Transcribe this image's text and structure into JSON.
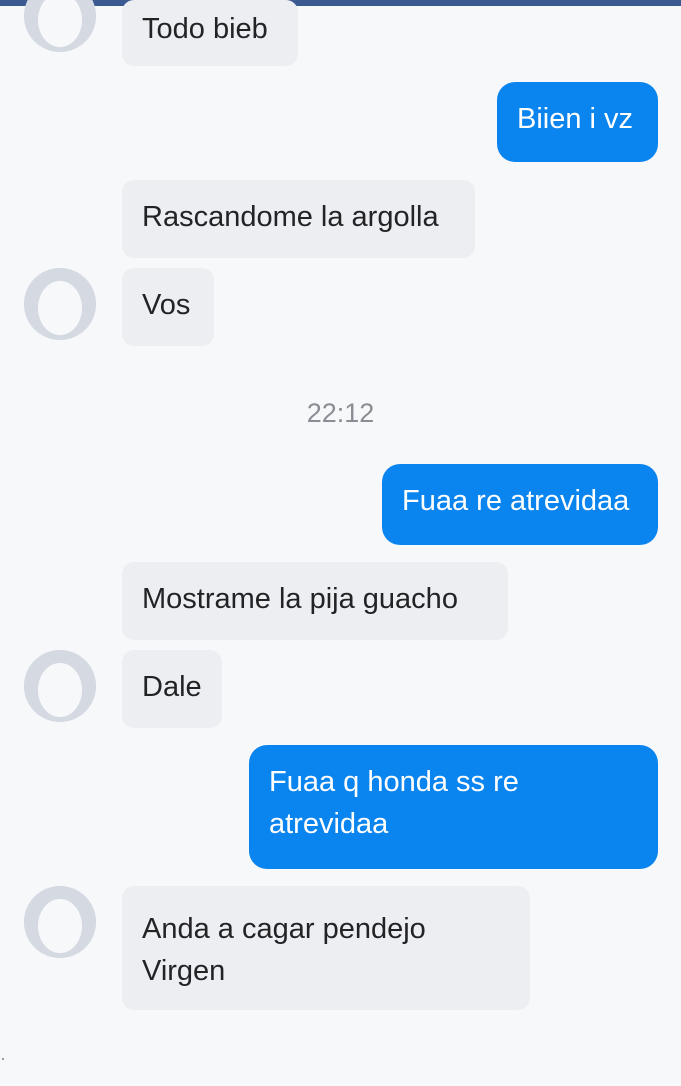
{
  "conversation": {
    "messages": [
      {
        "direction": "incoming",
        "text": "Todo bieb"
      },
      {
        "direction": "outgoing",
        "text": "Biien i vz"
      },
      {
        "direction": "incoming",
        "text": "Rascandome la argolla"
      },
      {
        "direction": "incoming",
        "text": "Vos"
      },
      {
        "direction": "outgoing",
        "text": "Fuaa re atrevidaa"
      },
      {
        "direction": "incoming",
        "text": "Mostrame  la pija guacho"
      },
      {
        "direction": "incoming",
        "text": "Dale"
      },
      {
        "direction": "outgoing",
        "text": "Fuaa q honda ss re atrevidaa"
      },
      {
        "direction": "incoming",
        "text": "Anda a cagar pendejo Virgen"
      }
    ],
    "timestamp": "22:12"
  },
  "colors": {
    "outgoing_bubble": "#0a84ee",
    "incoming_bubble": "#eceef2",
    "top_bar": "#3b5a92",
    "background": "#f7f8fa"
  },
  "icons": {
    "avatar": "default-profile-avatar-icon"
  }
}
